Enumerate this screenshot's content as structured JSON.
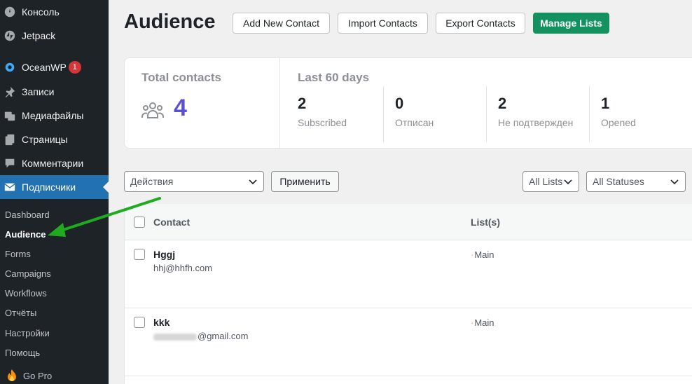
{
  "sidebar": {
    "items": [
      {
        "label": "Консоль",
        "icon": "dashboard-icon"
      },
      {
        "label": "Jetpack",
        "icon": "jetpack-icon"
      },
      {
        "label": "OceanWP",
        "icon": "oceanwp-icon",
        "badge": "1"
      },
      {
        "label": "Записи",
        "icon": "pin-icon"
      },
      {
        "label": "Медиафайлы",
        "icon": "media-icon"
      },
      {
        "label": "Страницы",
        "icon": "pages-icon"
      },
      {
        "label": "Комментарии",
        "icon": "comment-icon"
      },
      {
        "label": "Подписчики",
        "icon": "mail-icon",
        "active": true
      }
    ],
    "submenu": [
      "Dashboard",
      "Audience",
      "Forms",
      "Campaigns",
      "Workflows",
      "Отчёты",
      "Настройки",
      "Помощь"
    ],
    "go_pro": "Go Pro"
  },
  "header": {
    "title": "Audience",
    "buttons": {
      "add": "Add New Contact",
      "import": "Import Contacts",
      "export": "Export Contacts",
      "manage": "Manage Lists"
    }
  },
  "stats": {
    "total_title": "Total contacts",
    "total_value": "4",
    "last_title": "Last 60 days",
    "items": [
      {
        "value": "2",
        "label": "Subscribed"
      },
      {
        "value": "0",
        "label": "Отписан"
      },
      {
        "value": "2",
        "label": "Не подтвержден"
      },
      {
        "value": "1",
        "label": "Opened"
      }
    ]
  },
  "filters": {
    "actions": "Действия",
    "apply": "Применить",
    "lists": "All Lists",
    "statuses": "All Statuses"
  },
  "table": {
    "headers": {
      "contact": "Contact",
      "lists": "List(s)"
    },
    "rows": [
      {
        "name": "Hggj",
        "email": "hhj@hhfh.com",
        "list": "Main"
      },
      {
        "name": "kkk",
        "email": "@gmail.com",
        "list": "Main"
      }
    ]
  },
  "colors": {
    "accent_blue": "#2271b1",
    "primary_green": "#13915f",
    "total_purple": "#5b4fd8",
    "arrow_green": "#1faa1f"
  }
}
